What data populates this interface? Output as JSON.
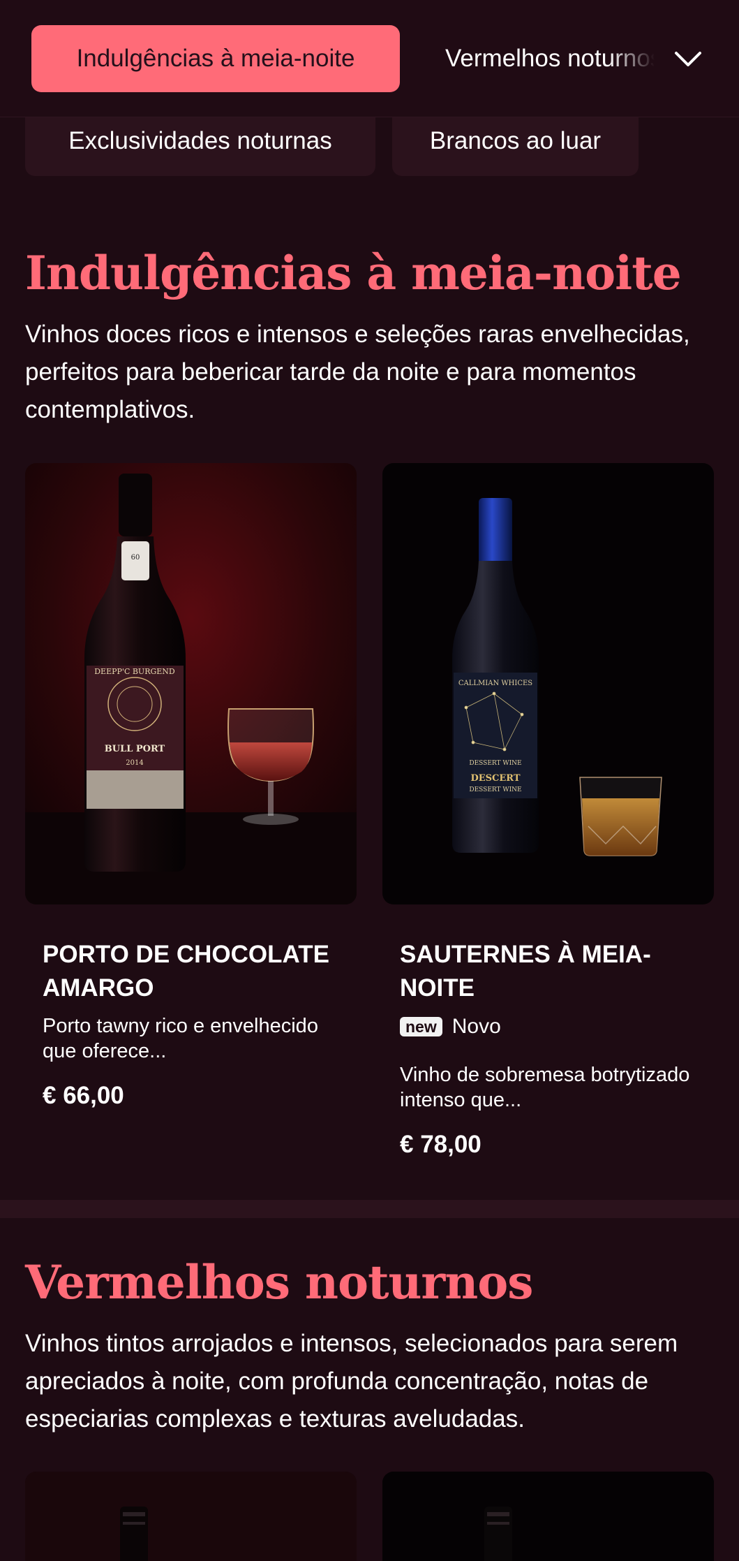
{
  "nav": {
    "active": "Indulgências à meia-noite",
    "next": "Vermelhos noturnos",
    "chevron_icon": "chevron-down-icon",
    "pills": [
      "Exclusividades noturnas",
      "Brancos ao luar"
    ]
  },
  "sections": [
    {
      "title": "Indulgências à meia-noite",
      "description": "Vinhos doces ricos e intensos e seleções raras envelhecidas, perfeitos para bebericar tarde da noite e para momentos contemplativos.",
      "products": [
        {
          "name": "Porto de chocolate amargo",
          "description": "Porto tawny rico e envelhecido que oferece...",
          "price": "€ 66,00",
          "label": {
            "line1": "DEEPP'C BURGEND",
            "line2": "BULL PORT",
            "line3": "2014"
          }
        },
        {
          "name": "Sauternes à meia-noite",
          "badge": "new",
          "badge_text": "Novo",
          "description": "Vinho de sobremesa botrytizado intenso que...",
          "price": "€ 78,00",
          "label": {
            "line1": "CALLMIAN WHICES",
            "line2": "DESSERT WINE",
            "line3": "DESCERT",
            "line4": "DESSERT WINE"
          }
        }
      ]
    },
    {
      "title": "Vermelhos noturnos",
      "description": "Vinhos tintos arrojados e intensos, selecionados para serem apreciados à noite, com profunda concentração, notas de especiarias complexas e texturas aveludadas."
    }
  ],
  "colors": {
    "background": "#1e0b13",
    "accent": "#ff6b78",
    "pill": "#2b121c"
  }
}
